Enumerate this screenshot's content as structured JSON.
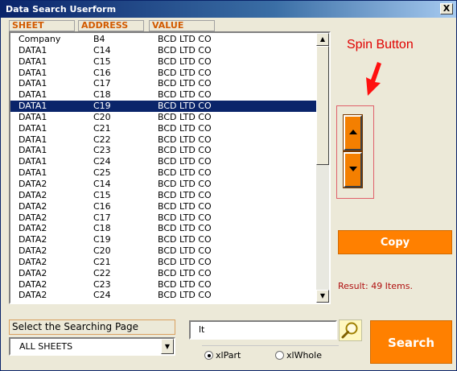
{
  "window": {
    "title": "Data Search Userform",
    "close_label": "X"
  },
  "list": {
    "columns": [
      "SHEET",
      "ADDRESS",
      "VALUE"
    ],
    "selected_index": 6,
    "rows": [
      [
        "Company",
        "B4",
        "BCD LTD CO"
      ],
      [
        "DATA1",
        "C14",
        "BCD LTD CO"
      ],
      [
        "DATA1",
        "C15",
        "BCD LTD CO"
      ],
      [
        "DATA1",
        "C16",
        "BCD LTD CO"
      ],
      [
        "DATA1",
        "C17",
        "BCD LTD CO"
      ],
      [
        "DATA1",
        "C18",
        "BCD LTD CO"
      ],
      [
        "DATA1",
        "C19",
        "BCD LTD CO"
      ],
      [
        "DATA1",
        "C20",
        "BCD LTD CO"
      ],
      [
        "DATA1",
        "C21",
        "BCD LTD CO"
      ],
      [
        "DATA1",
        "C22",
        "BCD LTD CO"
      ],
      [
        "DATA1",
        "C23",
        "BCD LTD CO"
      ],
      [
        "DATA1",
        "C24",
        "BCD LTD CO"
      ],
      [
        "DATA1",
        "C25",
        "BCD LTD CO"
      ],
      [
        "DATA2",
        "C14",
        "BCD LTD CO"
      ],
      [
        "DATA2",
        "C15",
        "BCD LTD CO"
      ],
      [
        "DATA2",
        "C16",
        "BCD LTD CO"
      ],
      [
        "DATA2",
        "C17",
        "BCD LTD CO"
      ],
      [
        "DATA2",
        "C18",
        "BCD LTD CO"
      ],
      [
        "DATA2",
        "C19",
        "BCD LTD CO"
      ],
      [
        "DATA2",
        "C20",
        "BCD LTD CO"
      ],
      [
        "DATA2",
        "C21",
        "BCD LTD CO"
      ],
      [
        "DATA2",
        "C22",
        "BCD LTD CO"
      ],
      [
        "DATA2",
        "C23",
        "BCD LTD CO"
      ],
      [
        "DATA2",
        "C24",
        "BCD LTD CO"
      ]
    ]
  },
  "annotation": {
    "label": "Spin Button"
  },
  "copy_label": "Copy",
  "result_text": "Result: 49 Items.",
  "page_select": {
    "label": "Select the Searching Page",
    "value": "ALL SHEETS"
  },
  "search": {
    "value": "lt",
    "button_label": "Search",
    "options": [
      "xlPart",
      "xlWhole"
    ],
    "selected_option": "xlPart"
  },
  "colors": {
    "accent": "#ff8000",
    "selection": "#0a246a",
    "header_text": "#d25a00",
    "result": "#b01010"
  }
}
